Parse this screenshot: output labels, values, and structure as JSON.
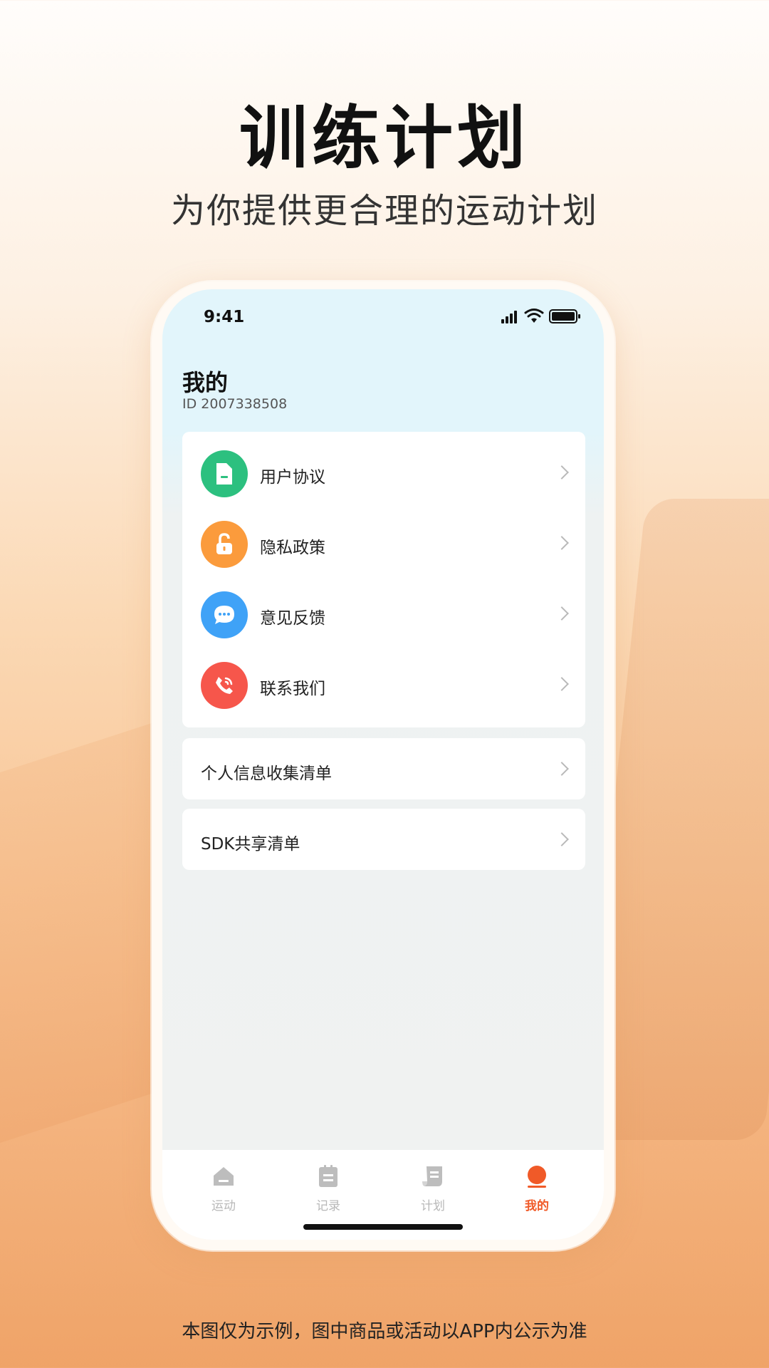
{
  "promo": {
    "headline": "训练计划",
    "subheadline": "为你提供更合理的运动计划",
    "disclaimer": "本图仅为示例，图中商品或活动以APP内公示为准"
  },
  "status_bar": {
    "time": "9:41",
    "icons": [
      "signal-icon",
      "wifi-icon",
      "battery-icon"
    ]
  },
  "profile": {
    "title": "我的",
    "user_id": "ID 2007338508"
  },
  "menu": {
    "items": [
      {
        "label": "用户协议",
        "icon": "document-icon",
        "color": "#2cc07f"
      },
      {
        "label": "隐私政策",
        "icon": "unlock-icon",
        "color": "#fb9b3c"
      },
      {
        "label": "意见反馈",
        "icon": "chat-bubble-icon",
        "color": "#3fa2f7"
      },
      {
        "label": "联系我们",
        "icon": "phone-icon",
        "color": "#f6564b"
      }
    ]
  },
  "lists": {
    "personal_info": "个人信息收集清单",
    "sdk_share": "SDK共享清单"
  },
  "tabbar": {
    "tabs": [
      {
        "label": "运动",
        "icon": "house-icon",
        "active": false
      },
      {
        "label": "记录",
        "icon": "clipboard-icon",
        "active": false
      },
      {
        "label": "计划",
        "icon": "scroll-icon",
        "active": false
      },
      {
        "label": "我的",
        "icon": "profile-dot-icon",
        "active": true
      }
    ],
    "active_color": "#f05a28",
    "inactive_color": "#b8b8b8"
  }
}
